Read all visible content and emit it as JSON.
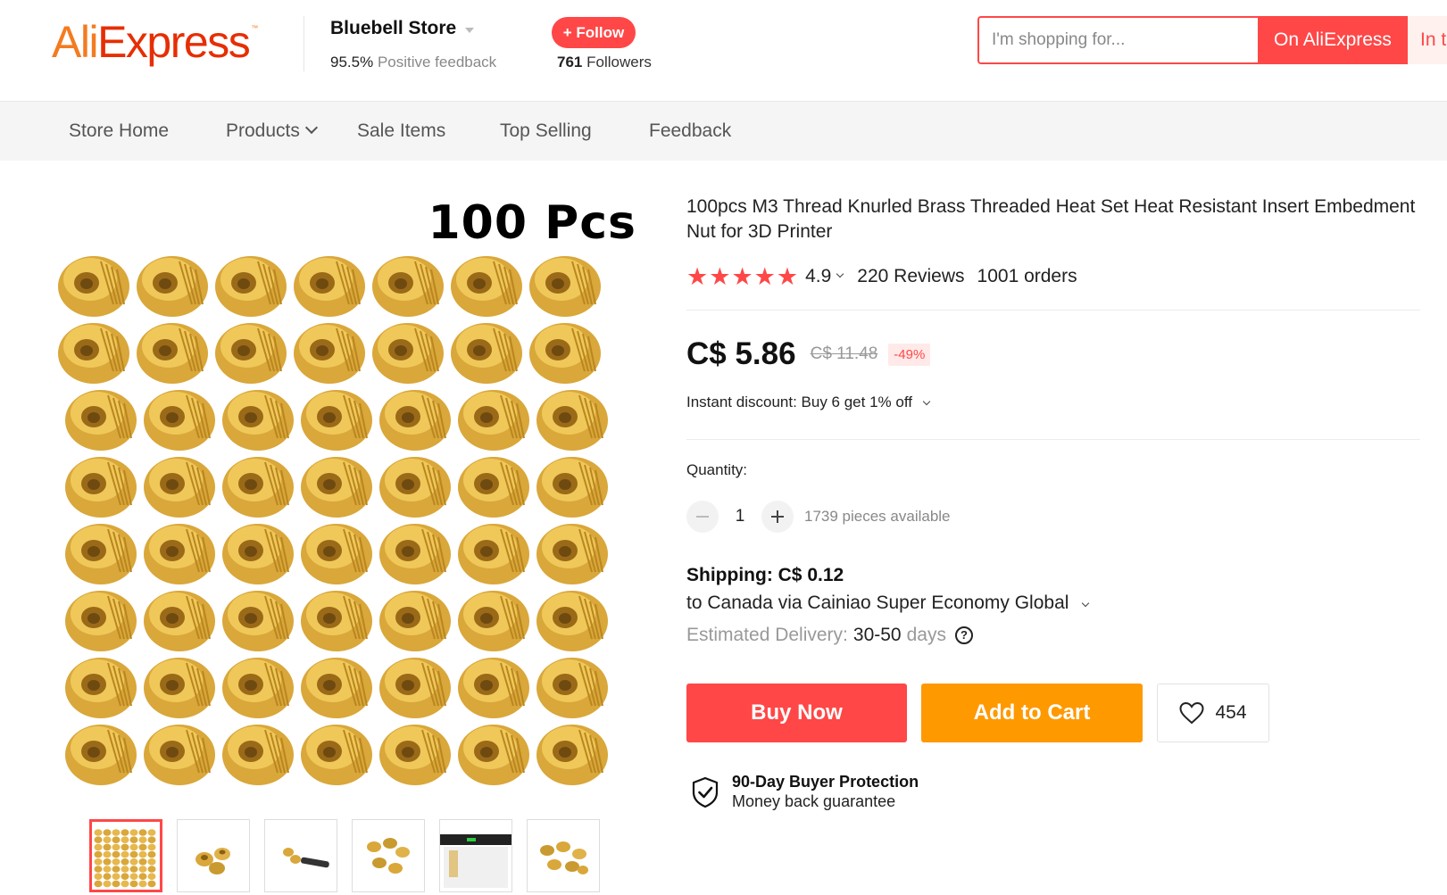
{
  "header": {
    "logo_text_a": "Ali",
    "logo_text_b": "Express",
    "logo_tm": "™",
    "store_name": "Bluebell Store",
    "feedback_pct": "95.5%",
    "feedback_label": "Positive feedback",
    "follow_label": "+ Follow",
    "followers_count": "761",
    "followers_label": "Followers",
    "search_placeholder": "I'm shopping for...",
    "search_on_label": "On AliExpress",
    "search_in_label": "In this store"
  },
  "nav": {
    "items": [
      "Store Home",
      "Products",
      "Sale Items",
      "Top Selling",
      "Feedback"
    ]
  },
  "gallery": {
    "main_image_label": "100 Pcs",
    "thumbnails": [
      "thumb-1",
      "thumb-2",
      "thumb-3",
      "thumb-4",
      "thumb-5",
      "thumb-6"
    ],
    "active_thumbnail": 0
  },
  "product": {
    "title": "100pcs M3 Thread Knurled Brass Threaded Heat Set Heat Resistant Insert Embedment Nut for 3D Printer",
    "stars": 5,
    "rating": "4.9",
    "reviews": "220 Reviews",
    "orders": "1001 orders",
    "price": "C$ 5.86",
    "original_price": "C$ 11.48",
    "discount": "-49%",
    "instant_discount": "Instant discount: Buy 6 get 1% off",
    "quantity_label": "Quantity:",
    "quantity": "1",
    "available": "1739 pieces available",
    "shipping": "Shipping: C$ 0.12",
    "shipping_method": "to Canada via Cainiao Super Economy Global",
    "delivery_label": "Estimated Delivery:",
    "delivery_value": "30-50",
    "delivery_unit": "days",
    "help_icon": "?",
    "buy_now": "Buy Now",
    "add_to_cart": "Add to Cart",
    "wishlist_count": "454",
    "protection_title": "90-Day Buyer Protection",
    "protection_sub": "Money back guarantee"
  },
  "colors": {
    "accent": "#ff4747",
    "cart": "#ff9900",
    "brass": "#d9a73a"
  }
}
